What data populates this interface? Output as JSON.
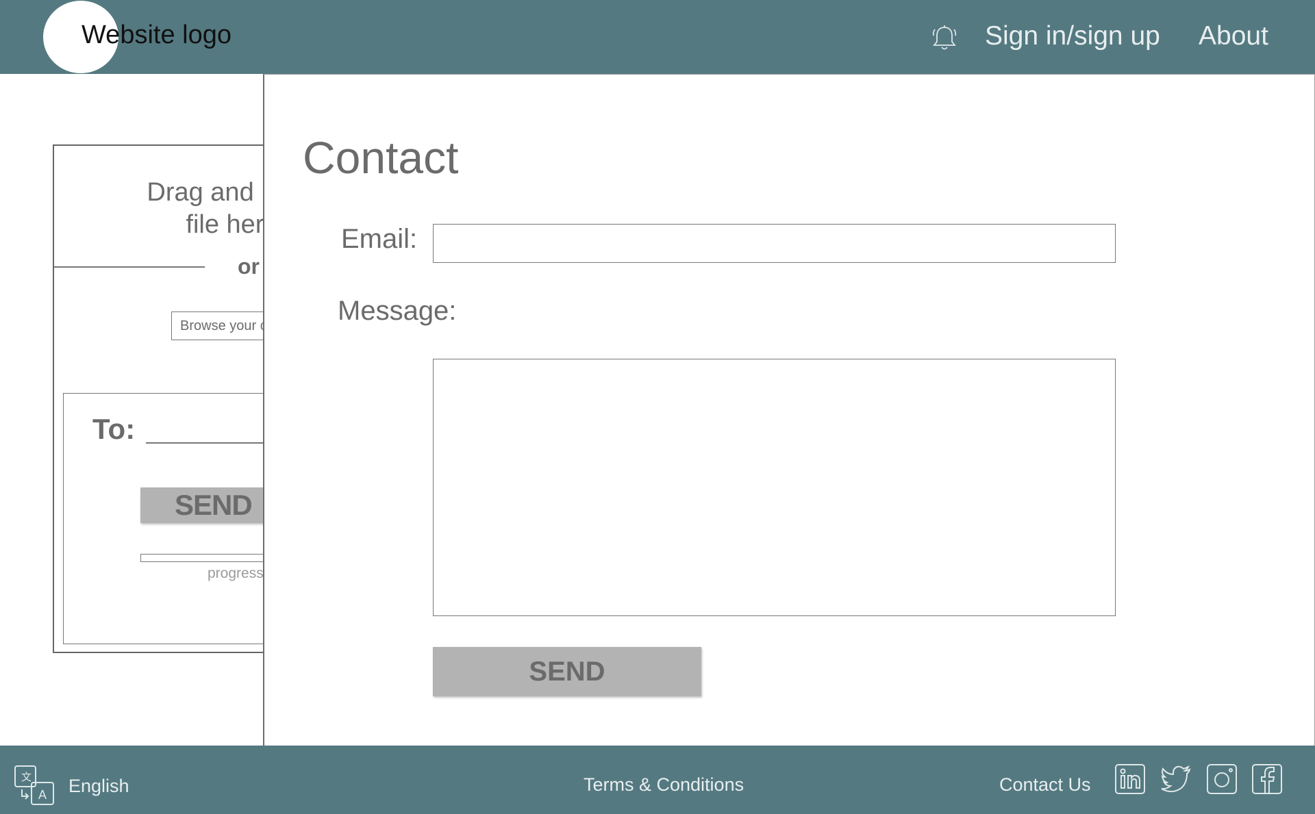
{
  "header": {
    "logo_text": "Website logo",
    "nav": {
      "signin": "Sign in/sign up",
      "about": "About"
    },
    "icons": {
      "notifications": "bell-icon"
    }
  },
  "upload_panel": {
    "drag_drop_text": "Drag and Drop file here",
    "or_text": "or",
    "browse_text": "Browse your computer",
    "to_label": "To:",
    "send_label": "SEND",
    "progress_label": "progress"
  },
  "contact": {
    "title": "Contact",
    "email_label": "Email:",
    "email_value": "",
    "message_label": "Message:",
    "message_value": "",
    "send_label": "SEND"
  },
  "footer": {
    "language": "English",
    "terms": "Terms & Conditions",
    "contact_us": "Contact Us",
    "social_icons": [
      "linkedin-icon",
      "twitter-icon",
      "instagram-icon",
      "facebook-icon"
    ]
  },
  "colors": {
    "bar": "#547981",
    "bar_text": "#e8eeef",
    "button": "#b3b3b3",
    "text_gray": "#6b6b6b"
  }
}
